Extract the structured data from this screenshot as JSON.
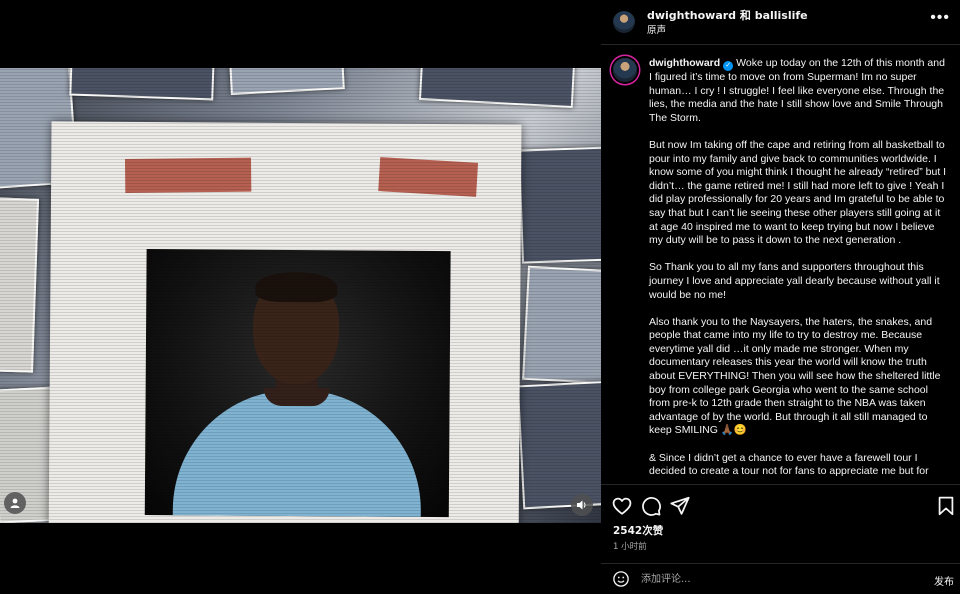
{
  "header": {
    "title": "dwighthoward 和 ballislife",
    "subtitle": "原声",
    "more_label": "•••"
  },
  "caption": {
    "username": "dwighthoward",
    "verified_mark": "✓",
    "paragraphs": [
      "Woke up today on the 12th of this month and I figured it’s time to move on from Superman! Im no super human… I cry ! I struggle! I feel like everyone else. Through the lies, the media and the hate I still show love and Smile Through The Storm.",
      "But now Im taking off the cape and retiring from all basketball to pour into my family and give back to communities worldwide. I know some of you might think I thought he already “retired” but I didn’t… the game retired me! I still had more left to give ! Yeah I did play professionally for 20 years and Im grateful to be able to say that but I can’t lie seeing these other players still going at it at age 40 inspired me to want to keep trying but now I believe my duty will be to pass it down to the next generation .",
      "So Thank you to all my fans and supporters throughout this journey I love and appreciate yall dearly because without yall it would be no me!",
      "Also thank you to the Naysayers, the haters, the snakes, and people that came into my life to try to destroy me. Because everytime yall did …it only made me stronger. When my documentary releases this year the world will know the truth about EVERYTHING! Then you will see how the sheltered little boy from college park Georgia who went to the same school from pre-k to 12th grade then straight to the NBA was taken advantage of by the world. But through it all still managed to keep SMILING 🙏🏾😊",
      "& Since I didn’t get a chance to ever have a farewell tour I decided to create a tour not for fans to appreciate me but for"
    ]
  },
  "stats": {
    "views": "2542次赞",
    "time_ago": "1 小时前"
  },
  "comment": {
    "placeholder": "添加评论...",
    "post_label": "发布"
  },
  "icons": {
    "like": "heart-icon",
    "comment": "comment-icon",
    "share": "share-icon",
    "save": "bookmark-icon",
    "emoji": "emoji-icon",
    "audio": "speaker-icon",
    "tagged": "user-tag-icon"
  },
  "colors": {
    "background": "#000000",
    "text": "#f5f5f5",
    "secondary_text": "#a8a8a8",
    "verified": "#0095f6",
    "divider": "#262626"
  }
}
